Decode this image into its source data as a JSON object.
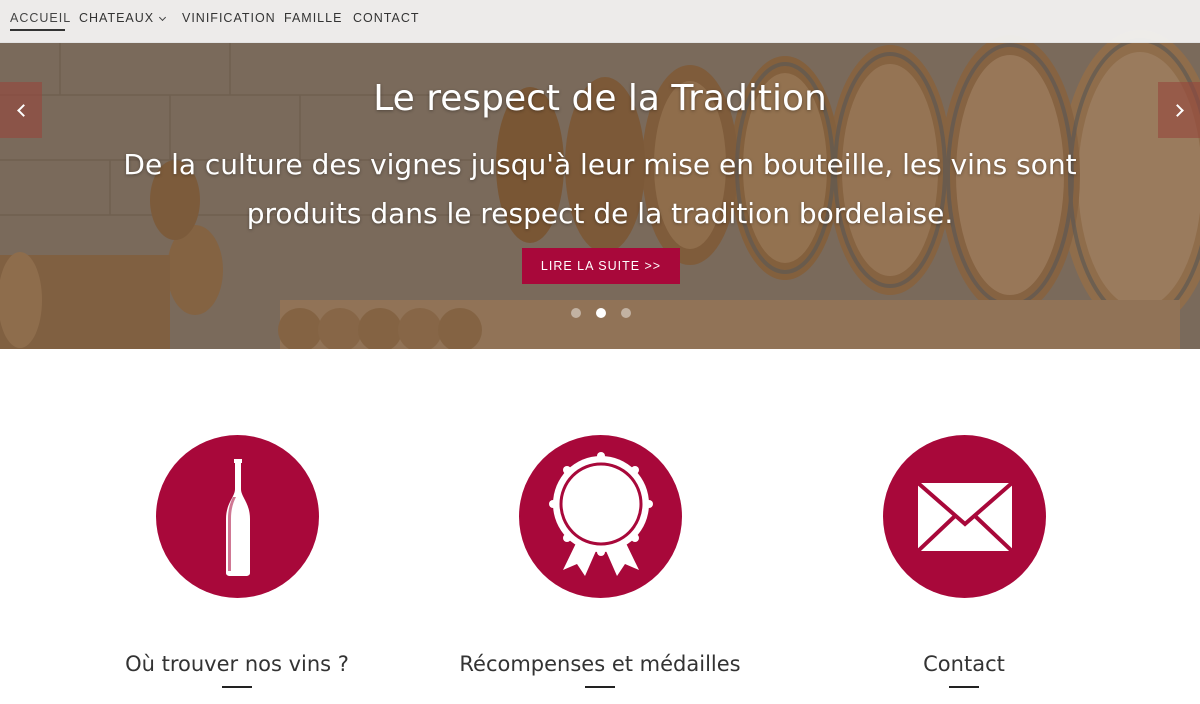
{
  "nav": {
    "items": [
      {
        "label": "ACCUEIL"
      },
      {
        "label": "CHATEAUX"
      },
      {
        "label": "VINIFICATION"
      },
      {
        "label": "FAMILLE"
      },
      {
        "label": "CONTACT"
      }
    ]
  },
  "hero": {
    "title": "Le respect de la Tradition",
    "text": "De la culture des vignes jusqu'à leur mise en bouteille, les vins sont produits dans le respect de la tradition bordelaise.",
    "button_label": "LIRE LA SUITE >>",
    "slide_count": 3,
    "active_slide": 2
  },
  "features": [
    {
      "title": "Où trouver nos vins ?",
      "icon": "wine-bottle-icon"
    },
    {
      "title": "Récompenses et médailles",
      "icon": "medal-rosette-icon"
    },
    {
      "title": "Contact",
      "icon": "envelope-icon"
    }
  ],
  "colors": {
    "accent": "#a8083a"
  }
}
